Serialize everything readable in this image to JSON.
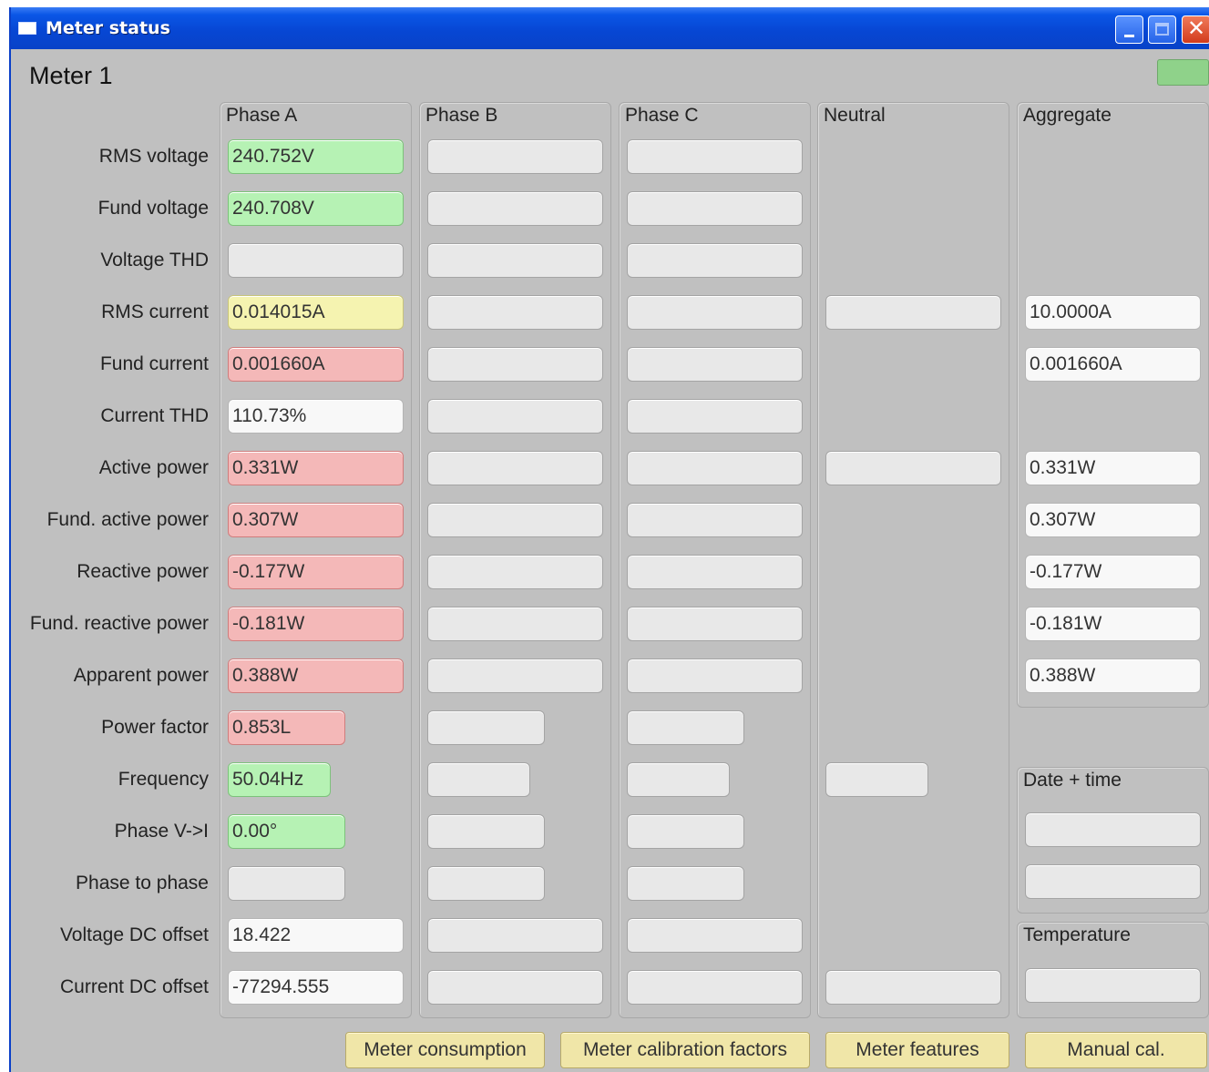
{
  "window": {
    "title": "Meter status"
  },
  "meter": {
    "title": "Meter 1",
    "status_color": "#8fd28a"
  },
  "groups": {
    "phase_a": "Phase A",
    "phase_b": "Phase B",
    "phase_c": "Phase C",
    "neutral": "Neutral",
    "aggregate": "Aggregate",
    "datetime": "Date + time",
    "temperature": "Temperature"
  },
  "rows": [
    "RMS voltage",
    "Fund voltage",
    "Voltage THD",
    "RMS current",
    "Fund current",
    "Current THD",
    "Active power",
    "Fund. active power",
    "Reactive power",
    "Fund. reactive power",
    "Apparent power",
    "Power factor",
    "Frequency",
    "Phase V->I",
    "Phase to phase",
    "Voltage DC offset",
    "Current DC offset"
  ],
  "phase_a": {
    "rms_voltage": "240.752V",
    "fund_voltage": "240.708V",
    "voltage_thd": "",
    "rms_current": "0.014015A",
    "fund_current": "0.001660A",
    "current_thd": "110.73%",
    "active_power": "0.331W",
    "fund_active_power": "0.307W",
    "reactive_power": "-0.177W",
    "fund_reactive_power": "-0.181W",
    "apparent_power": "0.388W",
    "power_factor": "0.853L",
    "frequency": "50.04Hz",
    "phase_v_i": "0.00°",
    "phase_to_phase": "",
    "voltage_dc_offset": "18.422",
    "current_dc_offset": "-77294.555"
  },
  "aggregate": {
    "rms_current": "10.0000A",
    "fund_current": "0.001660A",
    "active_power": "0.331W",
    "fund_active_power": "0.307W",
    "reactive_power": "-0.177W",
    "fund_reactive_power": "-0.181W",
    "apparent_power": "0.388W"
  },
  "status_colors": {
    "good": "#b6f2b4",
    "warning": "#f5f3b0",
    "alarm": "#f4b8b8",
    "neutral": "#e8e8e8"
  },
  "buttons": {
    "consumption": "Meter consumption",
    "calibration": "Meter calibration factors",
    "features": "Meter features",
    "manual_cal": "Manual cal."
  }
}
